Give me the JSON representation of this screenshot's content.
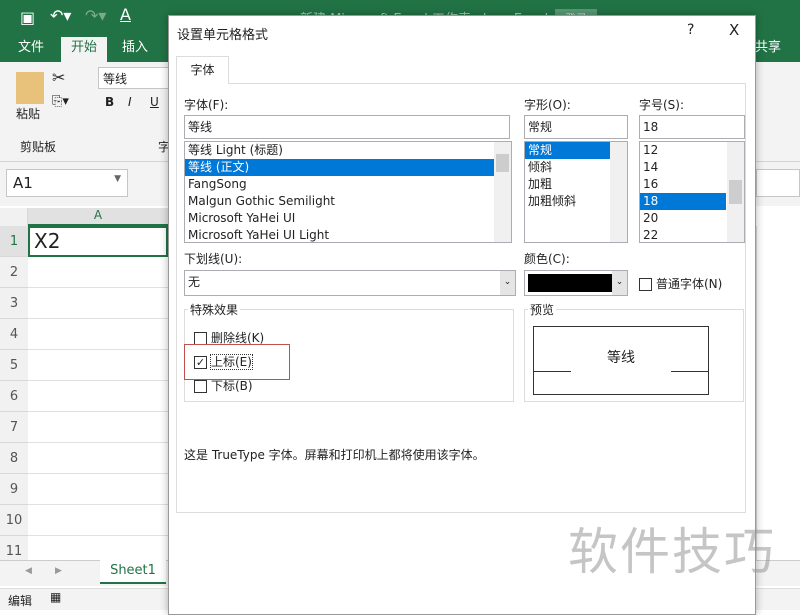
{
  "excel": {
    "title": "新建 Microsoft Excel 工作表.xlsx - Excel",
    "login": "登录",
    "tabs": [
      "文件",
      "开始",
      "插入"
    ],
    "share": "共享",
    "font_box": "等线",
    "paste": "粘贴",
    "clipboard": "剪贴板",
    "font_group": "字",
    "name_box": "A1",
    "col_a": "A",
    "rows": [
      "1",
      "2",
      "3",
      "4",
      "5",
      "6",
      "7",
      "8",
      "9",
      "10",
      "11"
    ],
    "cell_a1": "X2",
    "sheet_tab": "Sheet1",
    "status": "编辑",
    "accent": "#217346"
  },
  "dialog": {
    "title": "设置单元格格式",
    "help": "?",
    "close": "X",
    "tab": "字体",
    "font_label": "字体(F):",
    "font_value": "等线",
    "fonts": [
      "等线 Light (标题)",
      "等线 (正文)",
      "FangSong",
      "Malgun Gothic Semilight",
      "Microsoft YaHei UI",
      "Microsoft YaHei UI Light"
    ],
    "font_selected": 1,
    "style_label": "字形(O):",
    "style_value": "常规",
    "styles": [
      "常规",
      "倾斜",
      "加粗",
      "加粗倾斜"
    ],
    "size_label": "字号(S):",
    "size_value": "18",
    "sizes": [
      "12",
      "14",
      "16",
      "18",
      "20",
      "22"
    ],
    "size_selected": 3,
    "underline_label": "下划线(U):",
    "underline_value": "无",
    "color_label": "颜色(C):",
    "color_value": "#000000",
    "normal_font": "普通字体(N)",
    "effects_label": "特殊效果",
    "strikethrough": "删除线(K)",
    "superscript": "上标(E)",
    "subscript": "下标(B)",
    "strikethrough_checked": false,
    "superscript_checked": true,
    "subscript_checked": false,
    "preview_label": "预览",
    "preview_text": "等线",
    "info": "这是 TrueType 字体。屏幕和打印机上都将使用该字体。",
    "selection_color": "#0078d7"
  },
  "watermark": "软件技巧"
}
